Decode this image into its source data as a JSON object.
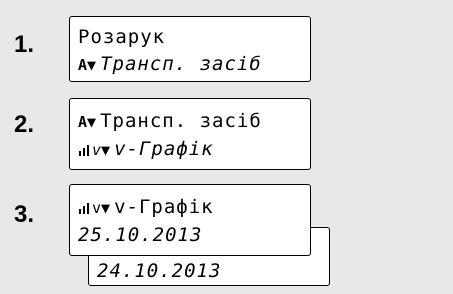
{
  "steps": [
    {
      "number": "1.",
      "lines": [
        {
          "text": "Розарук",
          "icon": ""
        },
        {
          "text": "Трансп. засіб",
          "icon": "vehicle-unit-arrow-icon"
        }
      ]
    },
    {
      "number": "2.",
      "lines": [
        {
          "text": "Трансп. засіб",
          "icon": "vehicle-unit-arrow-icon"
        },
        {
          "text": "v-Графік",
          "icon": "speed-profile-bars-icon"
        }
      ]
    },
    {
      "number": "3.",
      "lines": [
        {
          "text": "v-Графік",
          "icon": "speed-profile-bars-icon"
        },
        {
          "text": "25.10.2013",
          "icon": ""
        },
        {
          "text": "24.10.2013",
          "icon": ""
        }
      ]
    }
  ],
  "icons": {
    "vehicle_glyph": "А▼",
    "speed_glyph": "v▼"
  }
}
